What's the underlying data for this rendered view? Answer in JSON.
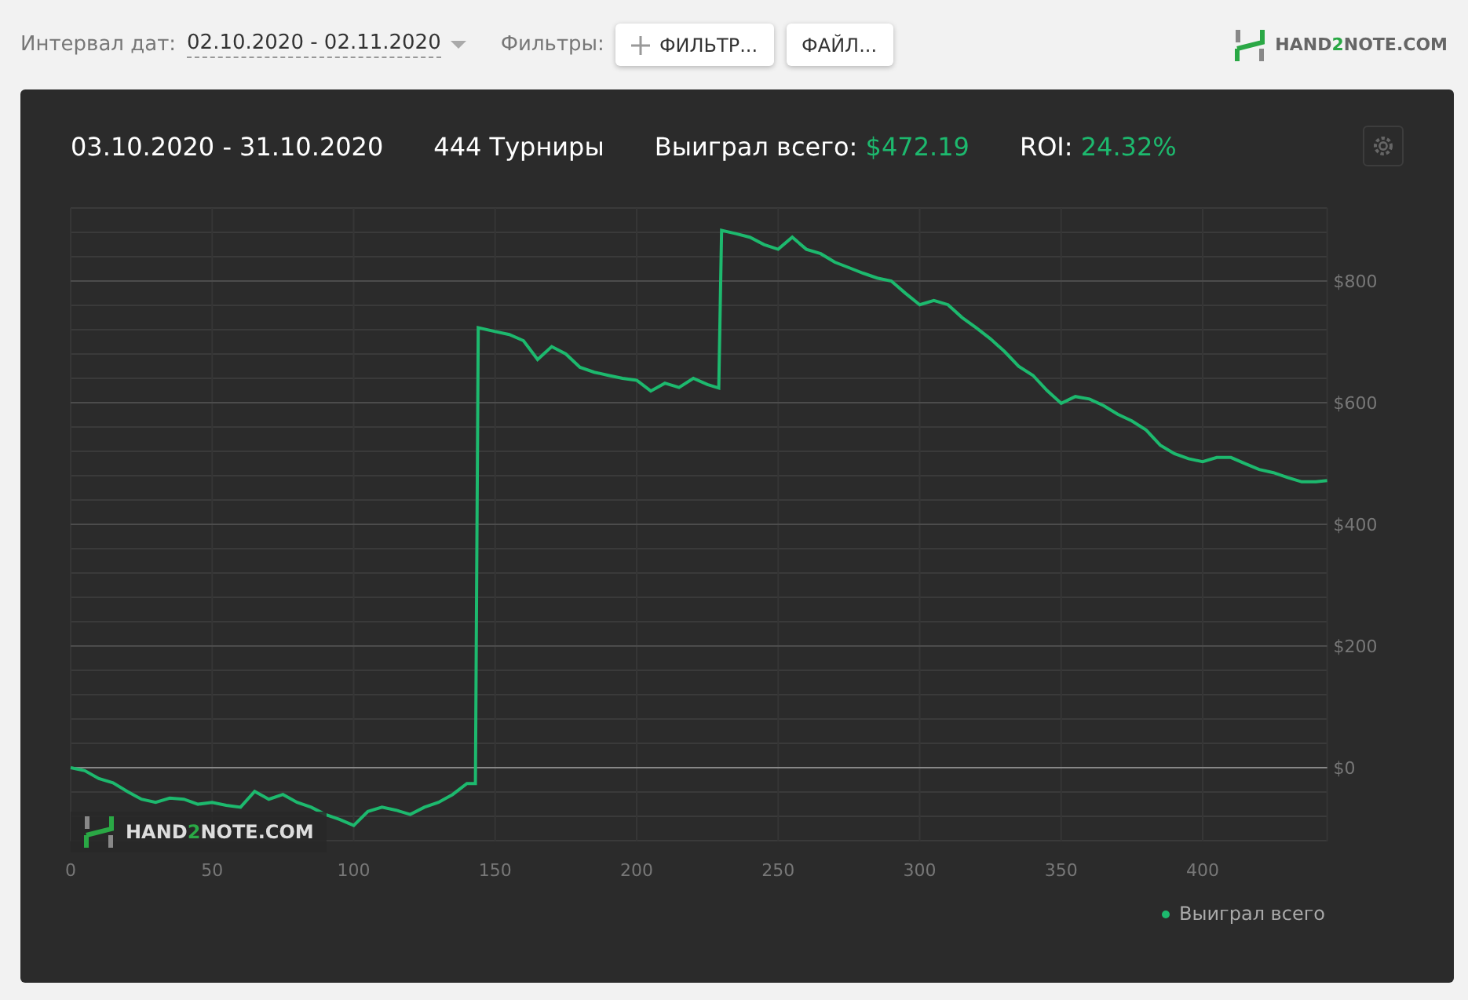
{
  "toolbar": {
    "date_label": "Интервал дат:",
    "date_value": "02.10.2020 - 02.11.2020",
    "filters_label": "Фильтры:",
    "buttons": [
      {
        "kind": "add",
        "label": "ФИЛЬТР..."
      },
      {
        "kind": "plain",
        "label": "ФАЙЛ..."
      }
    ],
    "logo": {
      "prefix": "HAND",
      "accent": "2",
      "suffix": "NOTE.COM"
    }
  },
  "panel": {
    "period": "03.10.2020 - 31.10.2020",
    "tournaments": "444 Турниры",
    "won_label": "Выиграл всего:",
    "won_value": "$472.19",
    "roi_label": "ROI:",
    "roi_value": "24.32%",
    "watermark": {
      "prefix": "HAND",
      "accent": "2",
      "suffix": "NOTE.COM"
    },
    "chart_data": {
      "type": "line",
      "x": [
        0,
        5,
        10,
        15,
        20,
        25,
        30,
        35,
        40,
        45,
        50,
        55,
        60,
        65,
        70,
        75,
        80,
        85,
        90,
        95,
        100,
        105,
        110,
        115,
        120,
        125,
        130,
        135,
        140,
        143,
        144,
        150,
        155,
        160,
        165,
        170,
        175,
        180,
        185,
        190,
        195,
        200,
        205,
        210,
        215,
        220,
        225,
        229,
        230,
        235,
        240,
        245,
        250,
        255,
        260,
        265,
        270,
        275,
        280,
        285,
        290,
        295,
        300,
        305,
        310,
        315,
        320,
        325,
        330,
        335,
        340,
        345,
        350,
        355,
        360,
        365,
        370,
        375,
        380,
        385,
        390,
        395,
        400,
        405,
        410,
        415,
        420,
        425,
        430,
        435,
        440,
        444
      ],
      "series": [
        {
          "name": "Выиграл всего",
          "color": "#1db96e",
          "values": [
            0,
            -5,
            -18,
            -25,
            -39,
            -52,
            -57,
            -50,
            -52,
            -60,
            -57,
            -62,
            -65,
            -39,
            -52,
            -44,
            -57,
            -65,
            -77,
            -85,
            -95,
            -72,
            -65,
            -70,
            -77,
            -65,
            -57,
            -44,
            -26,
            -26,
            723,
            717,
            712,
            702,
            671,
            692,
            680,
            658,
            650,
            645,
            640,
            637,
            619,
            632,
            625,
            640,
            630,
            624,
            883,
            878,
            872,
            860,
            852,
            872,
            852,
            845,
            831,
            822,
            813,
            805,
            800,
            780,
            761,
            768,
            761,
            740,
            723,
            705,
            684,
            660,
            645,
            620,
            599,
            610,
            606,
            595,
            581,
            570,
            555,
            530,
            516,
            508,
            503,
            510,
            510,
            500,
            490,
            485,
            477,
            470,
            470,
            472
          ]
        }
      ],
      "grid": true,
      "xlim": [
        0,
        444
      ],
      "ylim": [
        -121,
        920
      ],
      "xticks": [
        0,
        50,
        100,
        150,
        200,
        250,
        300,
        350,
        400
      ],
      "yticks": [
        {
          "value": 0,
          "label": "$0"
        },
        {
          "value": 200,
          "label": "$200"
        },
        {
          "value": 400,
          "label": "$400"
        },
        {
          "value": 600,
          "label": "$600"
        },
        {
          "value": 800,
          "label": "$800"
        }
      ]
    }
  }
}
